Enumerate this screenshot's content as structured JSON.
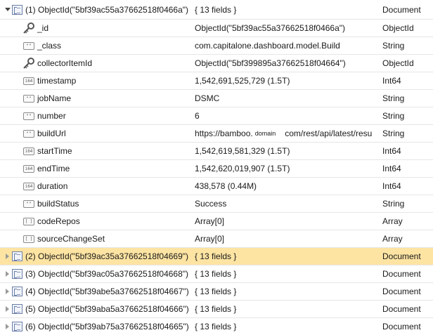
{
  "first_document": {
    "key": "(1) ObjectId(\"5bf39ac55a37662518f0466a\")",
    "value": "{ 13 fields }",
    "type": "Document",
    "fields": [
      {
        "key": "_id",
        "value": "ObjectId(\"5bf39ac55a37662518f0466a\")",
        "type": "ObjectId",
        "icon": "key-icon"
      },
      {
        "key": "_class",
        "value": "com.capitalone.dashboard.model.Build",
        "type": "String",
        "icon": "string-icon",
        "icon_text": "\"\""
      },
      {
        "key": "collectorItemId",
        "value": "ObjectId(\"5bf399895a37662518f04664\")",
        "type": "ObjectId",
        "icon": "key-icon"
      },
      {
        "key": "timestamp",
        "value": "1,542,691,525,729 (1.5T)",
        "type": "Int64",
        "icon": "int64-icon",
        "icon_text": "i64"
      },
      {
        "key": "jobName",
        "value": "DSMC",
        "type": "String",
        "icon": "string-icon",
        "icon_text": "\"\""
      },
      {
        "key": "number",
        "value": "6",
        "type": "String",
        "icon": "string-icon",
        "icon_text": "\"\""
      },
      {
        "key": "buildUrl",
        "value_prefix": "https://bamboo.",
        "value_mask": "domain",
        "value_suffix": "com/rest/api/latest/resu",
        "type": "String",
        "icon": "string-icon",
        "icon_text": "\"\""
      },
      {
        "key": "startTime",
        "value": "1,542,619,581,329 (1.5T)",
        "type": "Int64",
        "icon": "int64-icon",
        "icon_text": "i64"
      },
      {
        "key": "endTime",
        "value": "1,542,620,019,907 (1.5T)",
        "type": "Int64",
        "icon": "int64-icon",
        "icon_text": "i64"
      },
      {
        "key": "duration",
        "value": "438,578 (0.44M)",
        "type": "Int64",
        "icon": "int64-icon",
        "icon_text": "i64"
      },
      {
        "key": "buildStatus",
        "value": "Success",
        "type": "String",
        "icon": "string-icon",
        "icon_text": "\"\""
      },
      {
        "key": "codeRepos",
        "value": "Array[0]",
        "type": "Array",
        "icon": "array-icon",
        "icon_text": "[ ]"
      },
      {
        "key": "sourceChangeSet",
        "value": "Array[0]",
        "type": "Array",
        "icon": "array-icon",
        "icon_text": "[ ]"
      }
    ]
  },
  "documents": [
    {
      "key": "(2) ObjectId(\"5bf39ac35a37662518f04669\")",
      "value": "{ 13 fields }",
      "type": "Document",
      "selected": true
    },
    {
      "key": "(3) ObjectId(\"5bf39ac05a37662518f04668\")",
      "value": "{ 13 fields }",
      "type": "Document",
      "selected": false
    },
    {
      "key": "(4) ObjectId(\"5bf39abe5a37662518f04667\")",
      "value": "{ 13 fields }",
      "type": "Document",
      "selected": false
    },
    {
      "key": "(5) ObjectId(\"5bf39aba5a37662518f04666\")",
      "value": "{ 13 fields }",
      "type": "Document",
      "selected": false
    },
    {
      "key": "(6) ObjectId(\"5bf39ab75a37662518f04665\")",
      "value": "{ 13 fields }",
      "type": "Document",
      "selected": false
    }
  ],
  "colors": {
    "selected_row": "#fde4a3",
    "grid_line": "#e6e6e6",
    "doc_icon": "#6b7fa8"
  }
}
